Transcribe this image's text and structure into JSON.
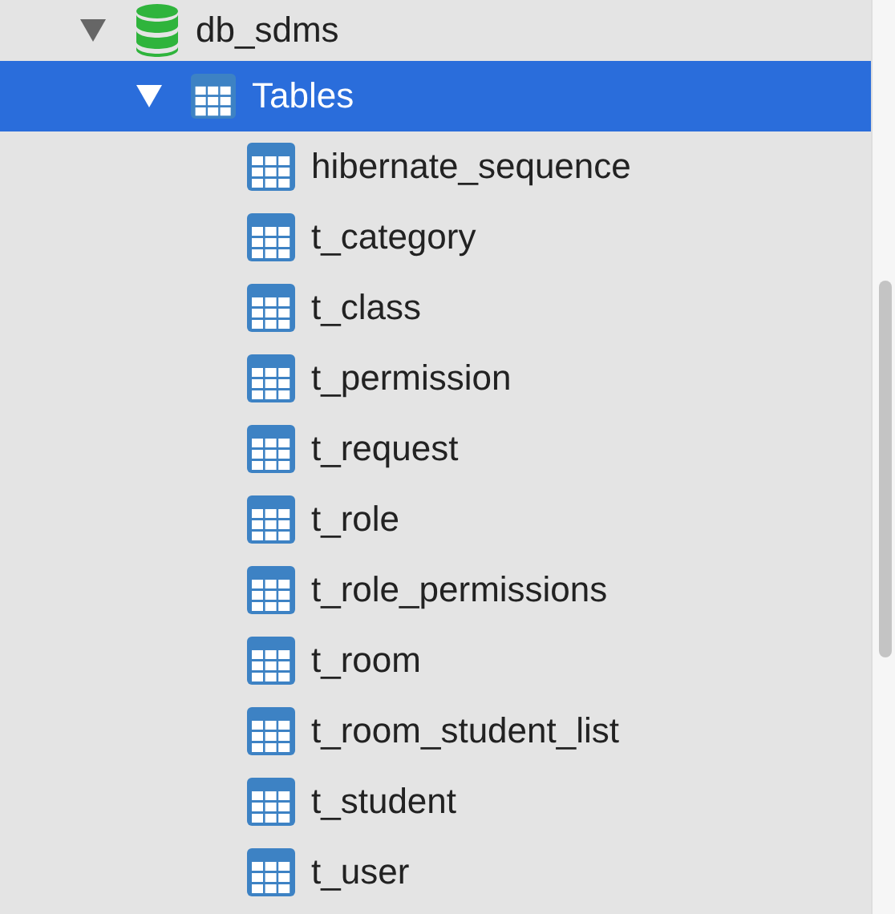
{
  "tree": [
    {
      "label": "db_sdms",
      "kind": "database",
      "expanded": true,
      "selected": false,
      "children": [
        {
          "label": "Tables",
          "kind": "folder",
          "expanded": true,
          "selected": true,
          "children": [
            {
              "label": "hibernate_sequence",
              "kind": "table",
              "selected": false
            },
            {
              "label": "t_category",
              "kind": "table",
              "selected": false
            },
            {
              "label": "t_class",
              "kind": "table",
              "selected": false
            },
            {
              "label": "t_permission",
              "kind": "table",
              "selected": false
            },
            {
              "label": "t_request",
              "kind": "table",
              "selected": false
            },
            {
              "label": "t_role",
              "kind": "table",
              "selected": false
            },
            {
              "label": "t_role_permissions",
              "kind": "table",
              "selected": false
            },
            {
              "label": "t_room",
              "kind": "table",
              "selected": false
            },
            {
              "label": "t_room_student_list",
              "kind": "table",
              "selected": false
            },
            {
              "label": "t_student",
              "kind": "table",
              "selected": false
            },
            {
              "label": "t_user",
              "kind": "table",
              "selected": false
            }
          ]
        }
      ]
    }
  ]
}
